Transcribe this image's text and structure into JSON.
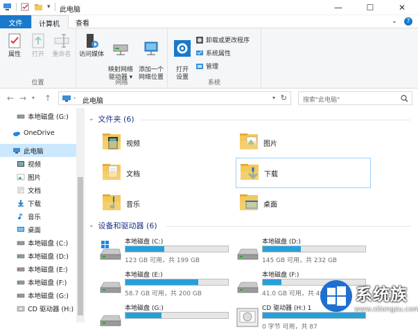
{
  "window": {
    "title": "此电脑",
    "minimize_glyph": "—",
    "maximize_glyph": "☐",
    "close_glyph": "✕"
  },
  "ribbon_tabs": {
    "file": "文件",
    "computer": "计算机",
    "view": "查看"
  },
  "ribbon_right": {
    "chevron": "⌄",
    "help": "?"
  },
  "ribbon": {
    "location": {
      "label": "位置",
      "properties": "属性",
      "open": "打开",
      "rename": "重命名"
    },
    "network": {
      "label": "网络",
      "access_media": "访问媒体",
      "map_drive": "映射网络\n驱动器 ▾",
      "add_location": "添加一个\n网络位置"
    },
    "system": {
      "label": "系统",
      "open_settings": "打开\n设置",
      "uninstall": "卸载或更改程序",
      "system_properties": "系统属性",
      "manage": "管理"
    }
  },
  "address": {
    "path": "此电脑",
    "search_placeholder": "搜索\"此电脑\""
  },
  "nav": {
    "items": [
      {
        "label": "本地磁盘 (G:)",
        "icon": "drive-icon"
      },
      {
        "label": "OneDrive",
        "icon": "onedrive-icon"
      },
      {
        "label": "此电脑",
        "icon": "pc-icon"
      },
      {
        "label": "视频",
        "icon": "video-folder-icon"
      },
      {
        "label": "图片",
        "icon": "pictures-folder-icon"
      },
      {
        "label": "文档",
        "icon": "documents-folder-icon"
      },
      {
        "label": "下载",
        "icon": "download-icon"
      },
      {
        "label": "音乐",
        "icon": "music-icon"
      },
      {
        "label": "桌面",
        "icon": "desktop-folder-icon"
      },
      {
        "label": "本地磁盘 (C:)",
        "icon": "drive-icon"
      },
      {
        "label": "本地磁盘 (D:)",
        "icon": "drive-icon"
      },
      {
        "label": "本地磁盘 (E:)",
        "icon": "drive-icon"
      },
      {
        "label": "本地磁盘 (F:)",
        "icon": "drive-icon"
      },
      {
        "label": "本地磁盘 (G:)",
        "icon": "drive-icon"
      },
      {
        "label": "CD 驱动器 (H:)",
        "icon": "cd-drive-icon"
      }
    ]
  },
  "folders_section": {
    "title": "文件夹 (6)",
    "items": [
      {
        "label": "视频"
      },
      {
        "label": "图片"
      },
      {
        "label": "文档"
      },
      {
        "label": "下载"
      },
      {
        "label": "音乐"
      },
      {
        "label": "桌面"
      }
    ]
  },
  "drives_section": {
    "title": "设备和驱动器 (6)",
    "items": [
      {
        "name": "本地磁盘 (C:)",
        "info": "123 GB 可用，共 199 GB",
        "used_fraction": 0.38
      },
      {
        "name": "本地磁盘 (D:)",
        "info": "145 GB 可用，共 232 GB",
        "used_fraction": 0.37
      },
      {
        "name": "本地磁盘 (E:)",
        "info": "58.7 GB 可用，共 200 GB",
        "used_fraction": 0.71
      },
      {
        "name": "本地磁盘 (F:)",
        "info": "41.0 GB 可用，共 49.9 G",
        "used_fraction": 0.18
      },
      {
        "name": "本地磁盘 (G:)",
        "info": "",
        "used_fraction": 0.35
      },
      {
        "name": "CD 驱动器 (H:) 1",
        "info": "0 字节 可用，共 87",
        "used_fraction": 1.0
      }
    ]
  },
  "watermark": {
    "text": "系统族",
    "url": "www.xitongzu.com"
  },
  "colors": {
    "accent": "#1979ca",
    "drive_bar": "#26a0da",
    "section_title": "#1e3287",
    "selection": "#cce8ff"
  }
}
